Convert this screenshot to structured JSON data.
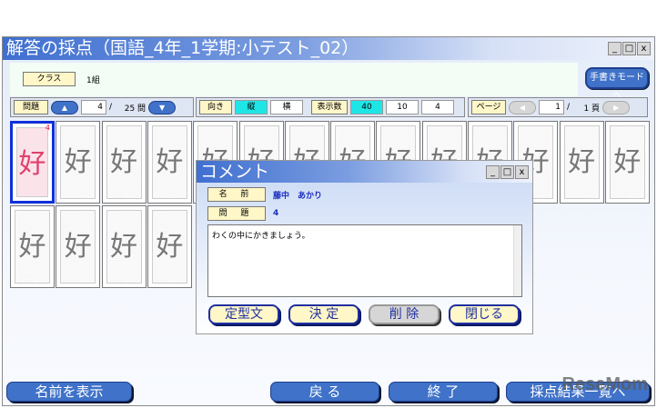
{
  "window": {
    "title": "解答の採点（国語_4年_1学期:小テスト_02）",
    "min": "_",
    "max": "□",
    "close": "x"
  },
  "class_bar": {
    "label": "クラス",
    "value": "1組",
    "handwriting_mode_button": "手書きモードへ"
  },
  "question_nav": {
    "label": "問題",
    "up": "▲",
    "current": "4",
    "separator": "/",
    "total": "25 問",
    "down": "▼"
  },
  "orientation": {
    "label": "向き",
    "options": [
      "縦",
      "横"
    ],
    "selected": "縦"
  },
  "display_count": {
    "label": "表示数",
    "options": [
      "40",
      "10",
      "4"
    ],
    "selected": "40"
  },
  "page_nav": {
    "label": "ページ",
    "prev": "◀",
    "current": "1",
    "separator": "/",
    "total": "1 頁",
    "next": "▶"
  },
  "answers": {
    "character": "好",
    "count": 18,
    "selected_index": 0,
    "selected_mark": "4"
  },
  "comment_dialog": {
    "title": "コメント",
    "min": "_",
    "max": "□",
    "close": "x",
    "name_label": "名 前",
    "name_value": "藤中　あかり",
    "question_label": "問 題",
    "question_value": "4",
    "comment": "わくの中にかきましょう。",
    "buttons": [
      "定型文",
      "決 定",
      "削 除",
      "閉じる"
    ]
  },
  "bottom_buttons": {
    "show_names": "名前を表示",
    "back": "戻 る",
    "exit": "終 了",
    "results": "採点結果一覧へ"
  },
  "watermark": "ReseMom"
}
